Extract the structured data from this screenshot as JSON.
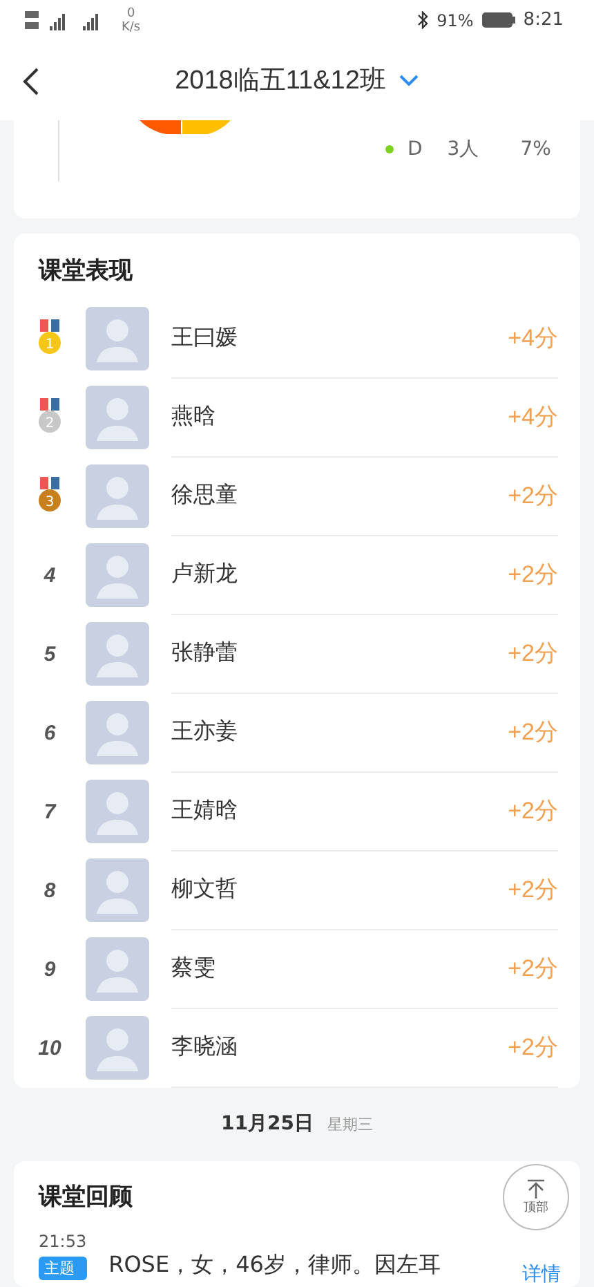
{
  "status_bar": {
    "speed_value": "0",
    "speed_unit": "K/s",
    "battery": "91%",
    "time": "8:21"
  },
  "header": {
    "title": "2018临五11&12班"
  },
  "stats_card": {
    "legend": [
      {
        "label": "D",
        "count": "3人",
        "percent": "7%",
        "color": "#7ed321"
      }
    ]
  },
  "performance": {
    "title": "课堂表现",
    "rows": [
      {
        "kind": "medal",
        "rank": "1",
        "color": "#f5c518",
        "name": "王曰媛",
        "score": "+4分"
      },
      {
        "kind": "medal",
        "rank": "2",
        "color": "#c8c8c8",
        "name": "燕晗",
        "score": "+4分"
      },
      {
        "kind": "medal",
        "rank": "3",
        "color": "#c7801c",
        "name": "徐思童",
        "score": "+2分"
      },
      {
        "kind": "number",
        "rank": "4",
        "name": "卢新龙",
        "score": "+2分"
      },
      {
        "kind": "number",
        "rank": "5",
        "name": "张静蕾",
        "score": "+2分"
      },
      {
        "kind": "number",
        "rank": "6",
        "name": "王亦姜",
        "score": "+2分"
      },
      {
        "kind": "number",
        "rank": "7",
        "name": "王婧晗",
        "score": "+2分"
      },
      {
        "kind": "number",
        "rank": "8",
        "name": "柳文哲",
        "score": "+2分"
      },
      {
        "kind": "number",
        "rank": "9",
        "name": "蔡雯",
        "score": "+2分"
      },
      {
        "kind": "number",
        "rank": "10",
        "name": "李晓涵",
        "score": "+2分"
      }
    ]
  },
  "date": {
    "day": "11月25日",
    "weekday": "星期三"
  },
  "review": {
    "title": "课堂回顾",
    "top_button": "顶部",
    "entry": {
      "time": "21:53",
      "tag": "主题",
      "text": "ROSE，女，46岁，律师。因左耳",
      "link": "详情"
    }
  }
}
